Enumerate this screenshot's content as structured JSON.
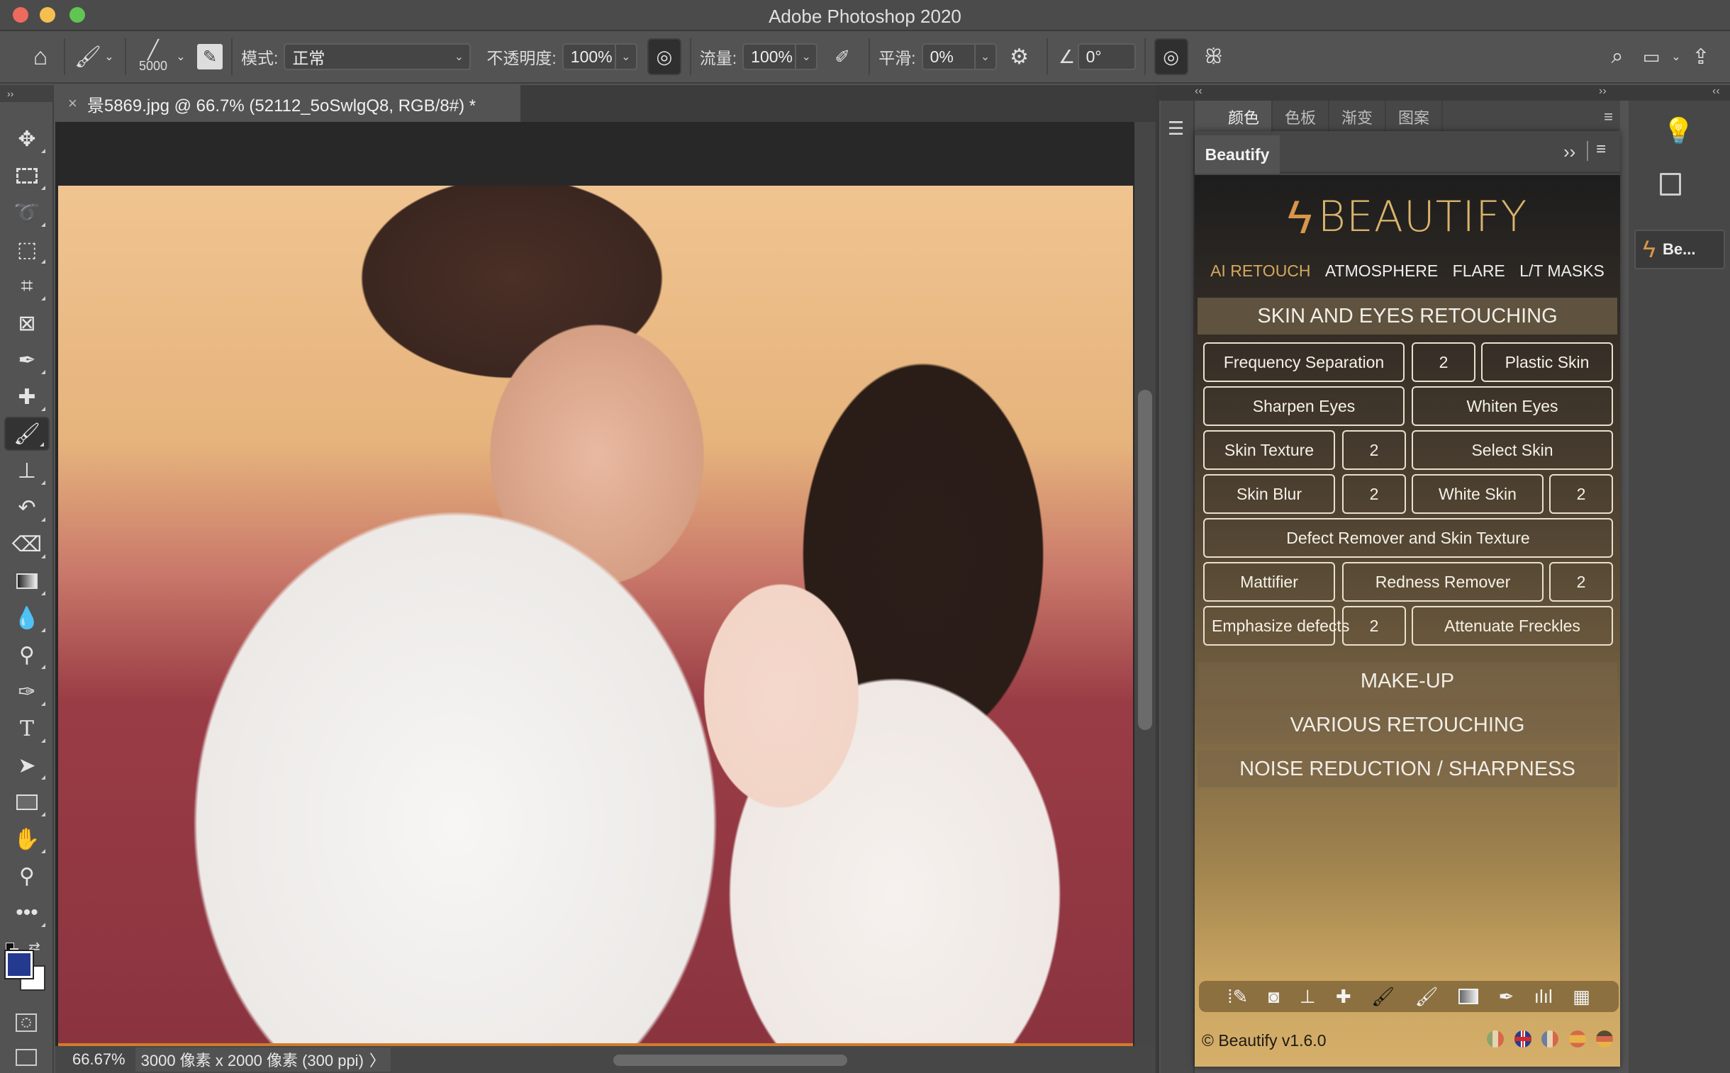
{
  "window": {
    "title": "Adobe Photoshop 2020",
    "traffic_lights": [
      "close",
      "minimize",
      "zoom"
    ]
  },
  "options_bar": {
    "brush_size": "5000",
    "mode_label": "模式:",
    "mode_value": "正常",
    "opacity_label": "不透明度:",
    "opacity_value": "100%",
    "flow_label": "流量:",
    "flow_value": "100%",
    "smoothing_label": "平滑:",
    "smoothing_value": "0%",
    "angle_value": "0°"
  },
  "document_tab": {
    "close": "×",
    "title": "景5869.jpg @ 66.7% (52112_5oSwlgQ8, RGB/8#) *"
  },
  "status_bar": {
    "zoom": "66.67%",
    "info": "3000 像素 x 2000 像素 (300 ppi)",
    "arrow": "〉"
  },
  "colors": {
    "foreground": "#233a8f",
    "background": "#ffffff",
    "accent_gold": "#d6a85e"
  },
  "panel_dock": {
    "collapse_left": "‹‹",
    "collapse_right": "››",
    "color_tabs": [
      "颜色",
      "色板",
      "渐变",
      "图案"
    ],
    "right_dock_item_label": "Be..."
  },
  "beautify": {
    "tab_label": "Beautify",
    "expand": "››",
    "logo_text": "BEAUTIFY",
    "nav": [
      {
        "label": "AI RETOUCH",
        "active": true
      },
      {
        "label": "ATMOSPHERE",
        "active": false
      },
      {
        "label": "FLARE",
        "active": false
      },
      {
        "label": "L/T MASKS",
        "active": false
      }
    ],
    "section_skin": "SKIN AND EYES RETOUCHING",
    "buttons": {
      "frequency_separation": "Frequency Separation",
      "frequency_separation_2": "2",
      "plastic_skin": "Plastic Skin",
      "sharpen_eyes": "Sharpen Eyes",
      "whiten_eyes": "Whiten Eyes",
      "skin_texture": "Skin Texture",
      "skin_texture_2": "2",
      "select_skin": "Select Skin",
      "skin_blur": "Skin Blur",
      "skin_blur_2": "2",
      "white_skin": "White Skin",
      "white_skin_2": "2",
      "defect_remover": "Defect Remover and Skin Texture",
      "mattifier": "Mattifier",
      "redness_remover": "Redness Remover",
      "redness_remover_2": "2",
      "emphasize_defects": "Emphasize defects",
      "emphasize_defects_2": "2",
      "attenuate_freckles": "Attenuate Freckles"
    },
    "section_makeup": "MAKE-UP",
    "section_various": "VARIOUS RETOUCHING",
    "section_noise": "NOISE REDUCTION / SHARPNESS",
    "footer_tools": [
      "selection-brush",
      "mask",
      "stamp",
      "healing",
      "black-brush",
      "white-brush",
      "gradient",
      "eyedropper",
      "histogram",
      "curves-grid"
    ],
    "copyright": "© Beautify v1.6.0",
    "languages": [
      {
        "code": "it",
        "colors": [
          "#8fa36b",
          "#e8d3b0",
          "#d6684a"
        ]
      },
      {
        "code": "en",
        "colors": [
          "#2a3b8f",
          "#ffffff",
          "#d02a2a"
        ]
      },
      {
        "code": "fr",
        "colors": [
          "#6a7fa0",
          "#e8d3b0",
          "#d6684a"
        ]
      },
      {
        "code": "es",
        "colors": [
          "#d6684a",
          "#e8b34a",
          "#d6684a"
        ]
      },
      {
        "code": "de",
        "colors": [
          "#5a4a32",
          "#d6684a",
          "#e8b34a"
        ]
      }
    ]
  }
}
